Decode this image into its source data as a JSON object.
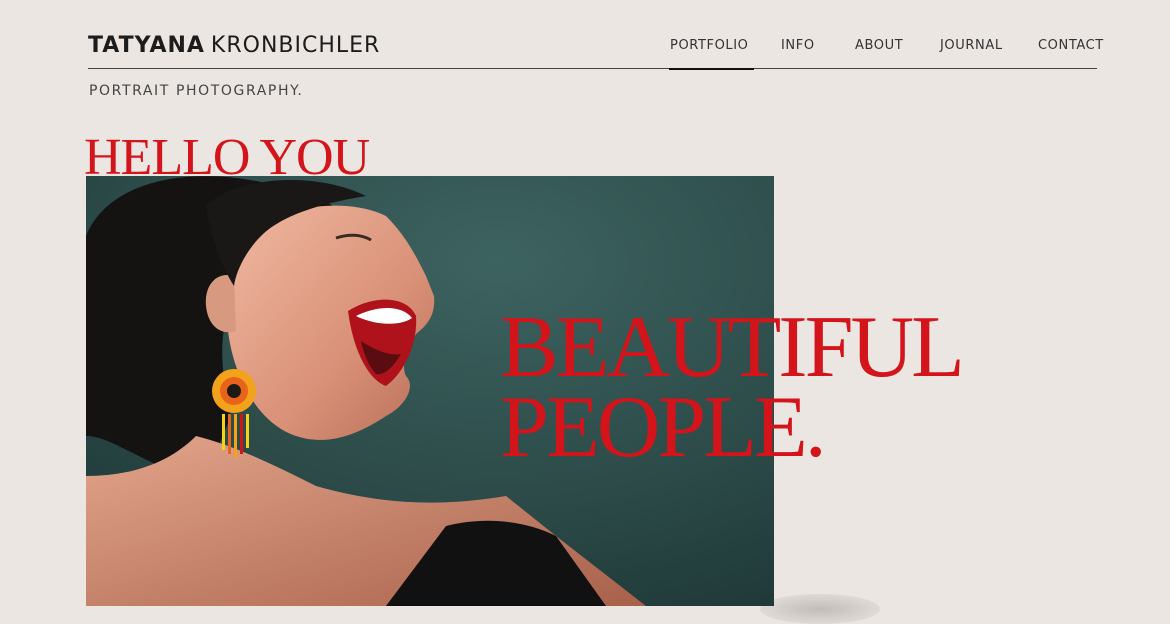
{
  "brand": {
    "first": "TATYANA",
    "last": "KRONBICHLER"
  },
  "tagline": "PORTRAIT PHOTOGRAPHY.",
  "nav": {
    "items": [
      {
        "label": "PORTFOLIO",
        "active": true
      },
      {
        "label": "INFO",
        "active": false
      },
      {
        "label": "ABOUT",
        "active": false
      },
      {
        "label": "JOURNAL",
        "active": false
      },
      {
        "label": "CONTACT",
        "active": false
      }
    ]
  },
  "hero": {
    "greeting": "HELLO YOU",
    "headline_line1": "BEAUTIFUL",
    "headline_line2": "PEOPLE."
  },
  "colors": {
    "accent": "#d3141a",
    "background": "#ece6e2",
    "photo_backdrop": "#2f4f4d"
  }
}
